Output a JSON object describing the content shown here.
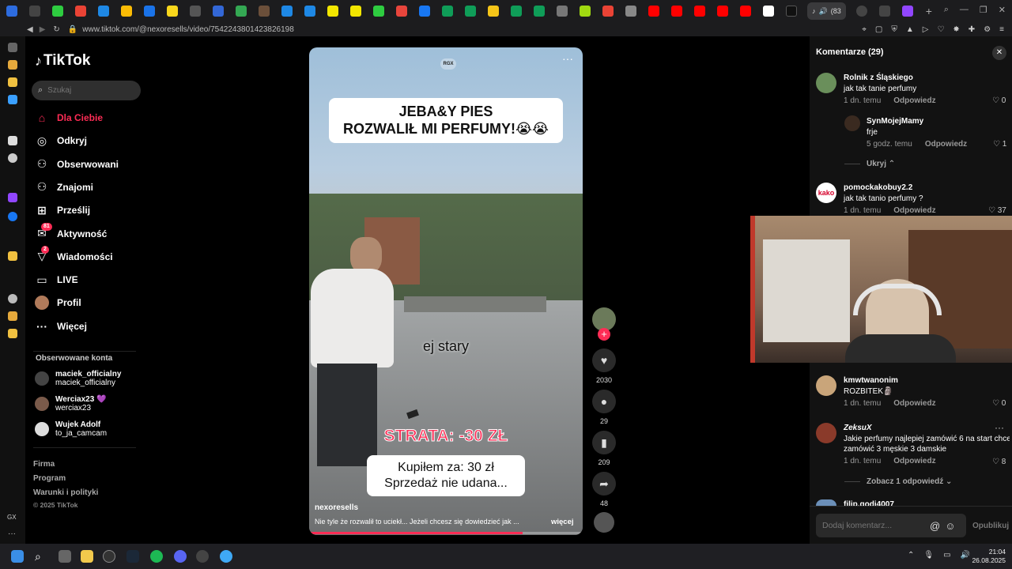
{
  "browser": {
    "url": "www.tiktok.com/@nexoresells/video/7542243801423826198",
    "active_tab_badge": "(83",
    "colors": {
      "tabbar": "#1c1c1e"
    }
  },
  "tiktok": {
    "logo_text": "TikTok",
    "search_placeholder": "Szukaj",
    "nav": [
      {
        "label": "Dla Ciebie",
        "icon": "home-icon",
        "glyph": "⌂",
        "active": true
      },
      {
        "label": "Odkryj",
        "icon": "compass-icon",
        "glyph": "◎"
      },
      {
        "label": "Obserwowani",
        "icon": "user-follow-icon",
        "glyph": "⚇"
      },
      {
        "label": "Znajomi",
        "icon": "friends-icon",
        "glyph": "⚇"
      },
      {
        "label": "Prześlij",
        "icon": "upload-icon",
        "glyph": "⊞"
      },
      {
        "label": "Aktywność",
        "icon": "activity-icon",
        "glyph": "✉",
        "badge": "81"
      },
      {
        "label": "Wiadomości",
        "icon": "messages-icon",
        "glyph": "▽",
        "badge": "2"
      },
      {
        "label": "LIVE",
        "icon": "live-icon",
        "glyph": "▭"
      },
      {
        "label": "Profil",
        "icon": "profile-avatar",
        "glyph": ""
      },
      {
        "label": "Więcej",
        "icon": "more-icon",
        "glyph": "···"
      }
    ],
    "followed_header": "Obserwowane konta",
    "followed": [
      {
        "name": "maciek_officialny",
        "handle": "maciek_officialny"
      },
      {
        "name": "Werciax23 💜",
        "handle": "werciax23"
      },
      {
        "name": "Wujek Adolf",
        "handle": "to_ja_camcam"
      }
    ],
    "footer": [
      "Firma",
      "Program",
      "Warunki i polityki"
    ],
    "copyright": "© 2025 TikTok",
    "accent": "#fe2c55"
  },
  "video": {
    "watermark": "RGX",
    "title_line1": "JEBA&Y PIES",
    "title_line2": "ROZWALIŁ MI PERFUMY!😭😭",
    "subtitle": "ej stary",
    "loss_text": "STRATA: -30 ZŁ",
    "box_line1": "Kupiłem za: 30 zł",
    "box_line2": "Sprzedaż nie udana...",
    "author": "nexoresells",
    "description": "Nie tyle że rozwalił to uciekł... Jeżeli chcesz się dowiedzieć jak ...",
    "more": "więcej",
    "progress": 0.78
  },
  "actions": {
    "likes": "2030",
    "comments": "29",
    "saves": "209",
    "shares": "48"
  },
  "comments_panel": {
    "title": "Komentarze (29)",
    "input_placeholder": "Dodaj komentarz...",
    "publish": "Opublikuj",
    "items": [
      {
        "user": "Rolnik z Śląskiego",
        "text": "jak tak tanie perfumy",
        "time": "1 dn. temu",
        "reply": "Odpowiedz",
        "likes": "0"
      },
      {
        "user": "SynMojejMamy",
        "text": "frje",
        "time": "5 godz. temu",
        "reply": "Odpowiedz",
        "likes": "1"
      },
      {
        "user": "pomockakobuy2.2",
        "text": "jak tak tanio perfumy ?",
        "time": "1 dn. temu",
        "reply": "Odpowiedz",
        "likes": "37"
      },
      {
        "user": "kmwtwanonim",
        "text": "ROZBITEK🗿",
        "time": "1 dn. temu",
        "reply": "Odpowiedz",
        "likes": "0"
      },
      {
        "user": "ZeksuX",
        "text": "Jakie perfumy najlepiej zamówić 6 na start chce",
        "text2": "zamówić 3 męskie 3 damskie",
        "time": "1 dn. temu",
        "reply": "Odpowiedz",
        "likes": "8"
      }
    ],
    "hide": "Ukryj ⌃",
    "see_reply": "Zobacz 1 odpowiedź ⌄",
    "next_user": "filip.godi4007"
  },
  "taskbar": {
    "time": "21:04",
    "date": "26.08.2025"
  }
}
